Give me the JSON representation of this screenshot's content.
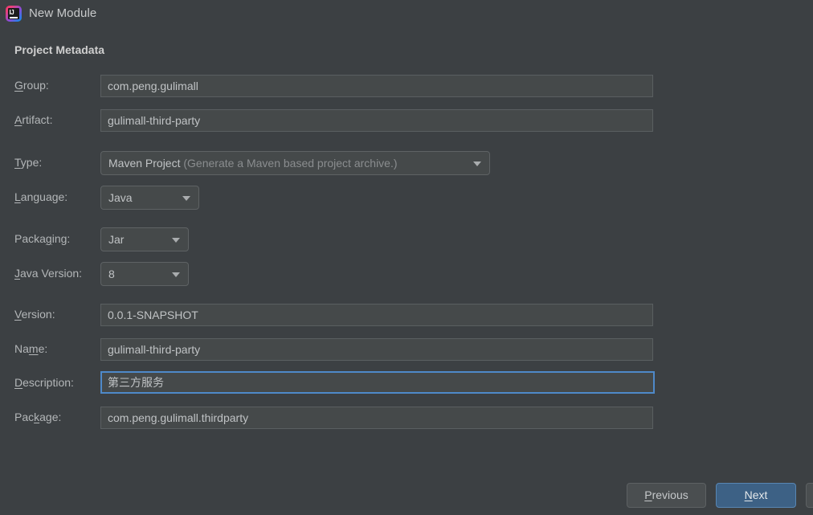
{
  "window": {
    "title": "New Module",
    "icon": "intellij-idea-icon",
    "icon_mark": "IJ"
  },
  "section": {
    "title": "Project Metadata"
  },
  "fields": [
    {
      "name": "group",
      "label_before": "",
      "label_mnemonic": "G",
      "label_after": "roup:",
      "type": "text",
      "value": "com.peng.gulimall",
      "focused": false
    },
    {
      "name": "artifact",
      "label_before": "",
      "label_mnemonic": "A",
      "label_after": "rtifact:",
      "type": "text",
      "value": "gulimall-third-party",
      "focused": false
    },
    {
      "name": "type",
      "label_before": "",
      "label_mnemonic": "T",
      "label_after": "ype:",
      "type": "combo",
      "value": "Maven Project",
      "value_hint": "(Generate a Maven based project archive.)"
    },
    {
      "name": "language",
      "label_before": "",
      "label_mnemonic": "L",
      "label_after": "anguage:",
      "type": "combo",
      "value": "Java",
      "value_hint": ""
    },
    {
      "name": "packaging",
      "label_before": "Packa",
      "label_mnemonic": "g",
      "label_after": "ing:",
      "type": "combo",
      "value": "Jar",
      "value_hint": ""
    },
    {
      "name": "java-version",
      "label_before": "",
      "label_mnemonic": "J",
      "label_after": "ava Version:",
      "type": "combo",
      "value": "8",
      "value_hint": ""
    },
    {
      "name": "version",
      "label_before": "",
      "label_mnemonic": "V",
      "label_after": "ersion:",
      "type": "text",
      "value": "0.0.1-SNAPSHOT",
      "focused": false
    },
    {
      "name": "name",
      "label_before": "Na",
      "label_mnemonic": "m",
      "label_after": "e:",
      "type": "text",
      "value": "gulimall-third-party",
      "focused": false
    },
    {
      "name": "description",
      "label_before": "",
      "label_mnemonic": "D",
      "label_after": "escription:",
      "type": "text",
      "value": "第三方服务",
      "focused": true
    },
    {
      "name": "package",
      "label_before": "Pac",
      "label_mnemonic": "k",
      "label_after": "age:",
      "type": "text",
      "value": "com.peng.gulimall.thirdparty",
      "focused": false
    }
  ],
  "buttons": {
    "previous": {
      "before": "",
      "mnemonic": "P",
      "after": "revious"
    },
    "next": {
      "before": "",
      "mnemonic": "N",
      "after": "ext"
    },
    "cut_off": {
      "label": ""
    }
  },
  "colors": {
    "dialog_background": "#3c4043",
    "field_background": "#45494a",
    "field_border": "#5a5f61",
    "focus_border": "#4e89c9",
    "default_button": "#3d6185",
    "text": "#b3b6b8"
  }
}
